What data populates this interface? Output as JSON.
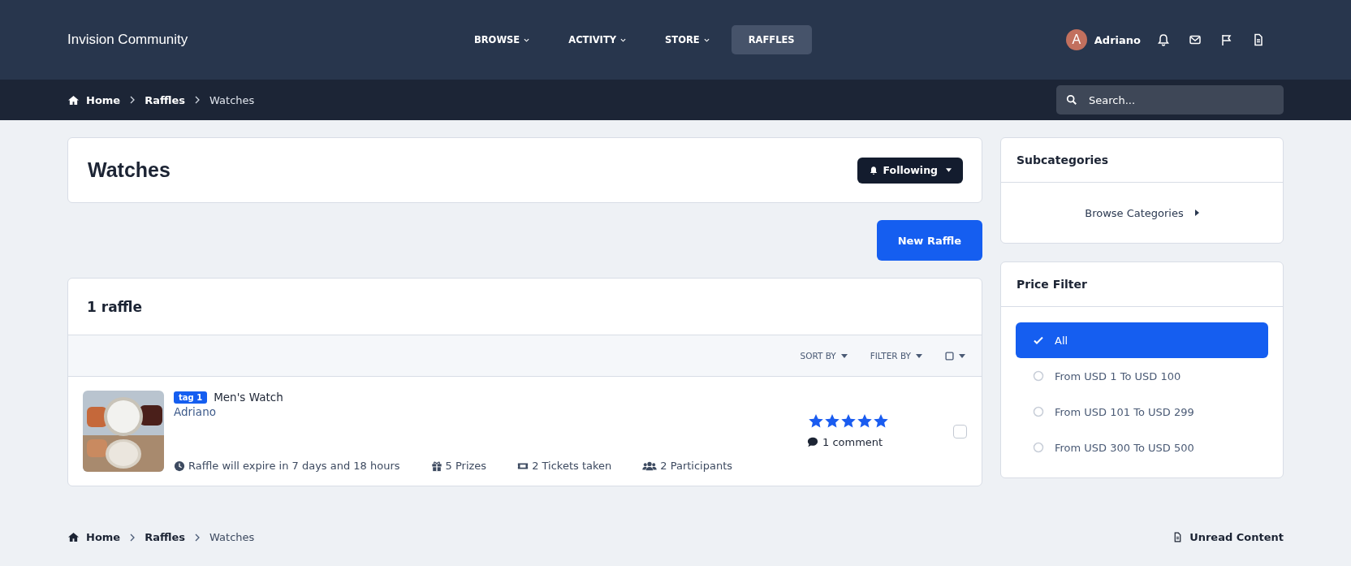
{
  "header": {
    "site_name": "Invision Community",
    "nav": [
      {
        "label": "BROWSE",
        "dropdown": true,
        "selected": false
      },
      {
        "label": "ACTIVITY",
        "dropdown": true,
        "selected": false
      },
      {
        "label": "STORE",
        "dropdown": true,
        "selected": false
      },
      {
        "label": "RAFFLES",
        "dropdown": false,
        "selected": true
      }
    ],
    "user": {
      "initial": "A",
      "name": "Adriano"
    }
  },
  "breadcrumb": [
    "Home",
    "Raffles",
    "Watches"
  ],
  "search": {
    "placeholder": "Search..."
  },
  "page": {
    "title": "Watches",
    "follow_button": "Following"
  },
  "new_button": "New Raffle",
  "list": {
    "title": "1 raffle",
    "sort_label": "SORT BY",
    "filter_label": "FILTER BY",
    "raffles": [
      {
        "tag": "tag 1",
        "title": "Men's Watch",
        "author": "Adriano",
        "expiry": "Raffle will expire in 7 days and 18 hours",
        "prizes": "5 Prizes",
        "tickets": "2 Tickets taken",
        "participants": "2 Participants",
        "stars": 5,
        "comments": "1 comment",
        "checked": false
      }
    ]
  },
  "sidebar": {
    "subcategories": {
      "title": "Subcategories",
      "link": "Browse Categories"
    },
    "price_filter": {
      "title": "Price Filter",
      "options": [
        {
          "label": "All",
          "selected": true
        },
        {
          "label": "From USD 1 To USD 100",
          "selected": false
        },
        {
          "label": "From USD 101 To USD 299",
          "selected": false
        },
        {
          "label": "From USD 300 To USD 500",
          "selected": false
        }
      ]
    }
  },
  "footer": {
    "breadcrumb": [
      "Home",
      "Raffles",
      "Watches"
    ],
    "unread": "Unread Content"
  }
}
